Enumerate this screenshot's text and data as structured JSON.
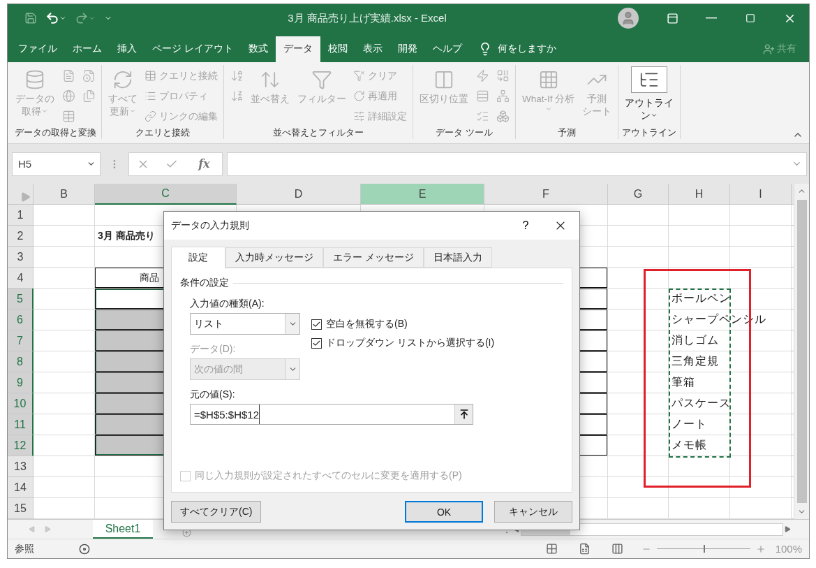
{
  "title_bar": {
    "title": "3月 商品売り上げ実績.xlsx  -  Excel"
  },
  "menu_tabs": [
    {
      "label": "ファイル",
      "selected": false
    },
    {
      "label": "ホーム",
      "selected": false
    },
    {
      "label": "挿入",
      "selected": false
    },
    {
      "label": "ページ レイアウト",
      "selected": false
    },
    {
      "label": "数式",
      "selected": false
    },
    {
      "label": "データ",
      "selected": true
    },
    {
      "label": "校閲",
      "selected": false
    },
    {
      "label": "表示",
      "selected": false
    },
    {
      "label": "開発",
      "selected": false
    },
    {
      "label": "ヘルプ",
      "selected": false
    }
  ],
  "tell_me": {
    "placeholder": "何をしますか"
  },
  "share": {
    "label": "共有",
    "disabled": true
  },
  "ribbon": {
    "groups": [
      {
        "label": "データの取得と変換",
        "items": [
          {
            "kind": "big",
            "lines": [
              "データの",
              "取得"
            ],
            "dropdown": true,
            "disabled": true
          },
          {
            "kind": "icon",
            "disabled": true
          },
          {
            "kind": "icon",
            "disabled": true
          },
          {
            "kind": "icon",
            "disabled": true
          },
          {
            "kind": "icon",
            "disabled": true
          },
          {
            "kind": "icon",
            "disabled": true
          }
        ]
      },
      {
        "label": "クエリと接続",
        "items": [
          {
            "kind": "big",
            "lines": [
              "すべて",
              "更新"
            ],
            "dropdown": true,
            "disabled": true
          },
          {
            "kind": "small",
            "label": "クエリと接続",
            "disabled": true
          },
          {
            "kind": "small",
            "label": "プロパティ",
            "disabled": true
          },
          {
            "kind": "small",
            "label": "リンクの編集",
            "disabled": true
          }
        ]
      },
      {
        "label": "並べ替えとフィルター",
        "items": [
          {
            "kind": "icon",
            "disabled": true
          },
          {
            "kind": "icon",
            "disabled": true
          },
          {
            "kind": "big",
            "lines": [
              "並べ替え"
            ],
            "dropdown": false,
            "disabled": true
          },
          {
            "kind": "big",
            "lines": [
              "フィルター"
            ],
            "dropdown": false,
            "disabled": true
          },
          {
            "kind": "small",
            "label": "クリア",
            "disabled": true
          },
          {
            "kind": "small",
            "label": "再適用",
            "disabled": true
          },
          {
            "kind": "small",
            "label": "詳細設定",
            "disabled": true
          }
        ]
      },
      {
        "label": "データ ツール",
        "items": [
          {
            "kind": "big",
            "lines": [
              "区切り位置"
            ],
            "dropdown": false,
            "disabled": true
          },
          {
            "kind": "icon",
            "disabled": true
          },
          {
            "kind": "icon",
            "disabled": true
          },
          {
            "kind": "icon",
            "disabled": true
          },
          {
            "kind": "icon",
            "disabled": true
          },
          {
            "kind": "icon",
            "disabled": true
          },
          {
            "kind": "icon",
            "disabled": true
          }
        ]
      },
      {
        "label": "予測",
        "items": [
          {
            "kind": "big",
            "lines": [
              "What-If 分析"
            ],
            "dropdown": true,
            "disabled": true
          },
          {
            "kind": "big",
            "lines": [
              "予測",
              "シート"
            ],
            "dropdown": false,
            "disabled": true
          }
        ]
      },
      {
        "label": "アウトライン",
        "items": [
          {
            "kind": "big",
            "lines": [
              "アウトライ",
              "ン"
            ],
            "dropdown": true,
            "disabled": false
          }
        ]
      }
    ]
  },
  "formula_bar": {
    "name_box": "H5",
    "function_button": "fx"
  },
  "sheet": {
    "marquee": true,
    "columns": [
      {
        "label": "B",
        "selected": false,
        "highlighted": false
      },
      {
        "label": "C",
        "selected": true,
        "highlighted": false
      },
      {
        "label": "D",
        "selected": false,
        "highlighted": false
      },
      {
        "label": "E",
        "selected": false,
        "highlighted": true
      },
      {
        "label": "F",
        "selected": false,
        "highlighted": false
      },
      {
        "label": "G",
        "selected": false,
        "highlighted": false
      },
      {
        "label": "H",
        "selected": false,
        "highlighted": false
      },
      {
        "label": "I",
        "selected": false,
        "highlighted": false
      }
    ],
    "rows": [
      {
        "label": "1",
        "selected": false,
        "cells": [
          {
            "bordered": false
          },
          {
            "bordered": false
          },
          {},
          {},
          {
            "bordered": false
          },
          {
            "bordered": false
          },
          {
            "bordered": false
          },
          {
            "bordered": false
          }
        ]
      },
      {
        "label": "2",
        "selected": false,
        "cells": [
          {
            "bordered": false
          },
          {
            "bordered": false,
            "kind": "title",
            "text": "3月 商品売り"
          },
          {},
          {},
          {
            "bordered": false
          },
          {
            "bordered": false
          },
          {
            "bordered": false
          },
          {
            "bordered": false
          }
        ]
      },
      {
        "label": "3",
        "selected": false,
        "cells": [
          {
            "bordered": false
          },
          {
            "bordered": false
          },
          {},
          {},
          {
            "bordered": false
          },
          {
            "bordered": false
          },
          {
            "bordered": false
          },
          {
            "bordered": false
          }
        ]
      },
      {
        "label": "4",
        "selected": false,
        "cells": [
          {
            "bordered": false
          },
          {
            "bordered": true,
            "kind": "header",
            "text": "商品"
          },
          {},
          {},
          {
            "bordered": true
          },
          {
            "bordered": false
          },
          {
            "bordered": false
          },
          {
            "bordered": false
          }
        ]
      },
      {
        "label": "5",
        "selected": true,
        "cells": [
          {
            "bordered": false
          },
          {
            "bordered": true
          },
          {},
          {},
          {
            "bordered": true
          },
          {
            "bordered": false
          },
          {
            "bordered": false,
            "kind": "text",
            "text": "ボールペン"
          },
          {
            "bordered": false
          }
        ]
      },
      {
        "label": "6",
        "selected": true,
        "cells": [
          {
            "bordered": false
          },
          {
            "bordered": true
          },
          {},
          {},
          {
            "bordered": true
          },
          {
            "bordered": false
          },
          {
            "bordered": false,
            "kind": "text",
            "text": "シャープペンシル"
          },
          {
            "bordered": false
          }
        ]
      },
      {
        "label": "7",
        "selected": true,
        "cells": [
          {
            "bordered": false
          },
          {
            "bordered": true
          },
          {},
          {},
          {
            "bordered": true
          },
          {
            "bordered": false
          },
          {
            "bordered": false,
            "kind": "text",
            "text": "消しゴム"
          },
          {
            "bordered": false
          }
        ]
      },
      {
        "label": "8",
        "selected": true,
        "cells": [
          {
            "bordered": false
          },
          {
            "bordered": true
          },
          {},
          {},
          {
            "bordered": true
          },
          {
            "bordered": false
          },
          {
            "bordered": false,
            "kind": "text",
            "text": "三角定規"
          },
          {
            "bordered": false
          }
        ]
      },
      {
        "label": "9",
        "selected": true,
        "cells": [
          {
            "bordered": false
          },
          {
            "bordered": true
          },
          {},
          {},
          {
            "bordered": true
          },
          {
            "bordered": false
          },
          {
            "bordered": false,
            "kind": "text",
            "text": "筆箱"
          },
          {
            "bordered": false
          }
        ]
      },
      {
        "label": "10",
        "selected": true,
        "cells": [
          {
            "bordered": false
          },
          {
            "bordered": true
          },
          {},
          {},
          {
            "bordered": true
          },
          {
            "bordered": false
          },
          {
            "bordered": false,
            "kind": "text",
            "text": "パスケース"
          },
          {
            "bordered": false
          }
        ]
      },
      {
        "label": "11",
        "selected": true,
        "cells": [
          {
            "bordered": false
          },
          {
            "bordered": true
          },
          {},
          {},
          {
            "bordered": true
          },
          {
            "bordered": false
          },
          {
            "bordered": false,
            "kind": "text",
            "text": "ノート"
          },
          {
            "bordered": false
          }
        ]
      },
      {
        "label": "12",
        "selected": true,
        "cells": [
          {
            "bordered": false
          },
          {
            "bordered": true
          },
          {},
          {},
          {
            "bordered": true
          },
          {
            "bordered": false
          },
          {
            "bordered": false,
            "kind": "text",
            "text": "メモ帳"
          },
          {
            "bordered": false
          }
        ]
      },
      {
        "label": "13",
        "selected": false,
        "cells": [
          {
            "bordered": false
          },
          {
            "bordered": false
          },
          {},
          {},
          {
            "bordered": false
          },
          {
            "bordered": false
          },
          {
            "bordered": false
          },
          {
            "bordered": false
          }
        ]
      },
      {
        "label": "14",
        "selected": false,
        "cells": [
          {
            "bordered": false
          },
          {
            "bordered": false
          },
          {},
          {},
          {
            "bordered": false
          },
          {
            "bordered": false
          },
          {
            "bordered": false
          },
          {
            "bordered": false
          }
        ]
      },
      {
        "label": "15",
        "selected": false,
        "cells": [
          {
            "bordered": false
          },
          {
            "bordered": false
          },
          {},
          {},
          {
            "bordered": false
          },
          {
            "bordered": false
          },
          {
            "bordered": false
          },
          {
            "bordered": false
          }
        ]
      }
    ]
  },
  "sheet_tabs": [
    {
      "label": "Sheet1",
      "selected": true
    }
  ],
  "status_bar": {
    "mode": "参照",
    "zoom": {
      "level": 0.5,
      "label": "100%"
    }
  },
  "dialog": {
    "title": "データの入力規則",
    "help": "?",
    "tabs": [
      {
        "label": "設定",
        "selected": true
      },
      {
        "label": "入力時メッセージ",
        "selected": false
      },
      {
        "label": "エラー メッセージ",
        "selected": false
      },
      {
        "label": "日本語入力",
        "selected": false
      }
    ],
    "group_title": "条件の設定",
    "allow": {
      "label": "入力値の種類(A):",
      "value": "リスト",
      "disabled": false
    },
    "data": {
      "label": "データ(D):",
      "value": "次の値の間",
      "disabled": true
    },
    "checkboxes": [
      {
        "label": "空白を無視する(B)",
        "checked": true,
        "disabled": false
      },
      {
        "label": "ドロップダウン リストから選択する(I)",
        "checked": true,
        "disabled": false
      }
    ],
    "source": {
      "label": "元の値(S):",
      "value": "=$H$5:$H$12"
    },
    "apply_all": {
      "label": "同じ入力規則が設定されたすべてのセルに変更を適用する(P)",
      "checked": false,
      "disabled": true
    },
    "buttons": [
      {
        "label": "すべてクリア(C)",
        "kind": "clear"
      },
      {
        "label": "OK",
        "kind": "default"
      },
      {
        "label": "キャンセル",
        "kind": "cancel"
      }
    ]
  }
}
